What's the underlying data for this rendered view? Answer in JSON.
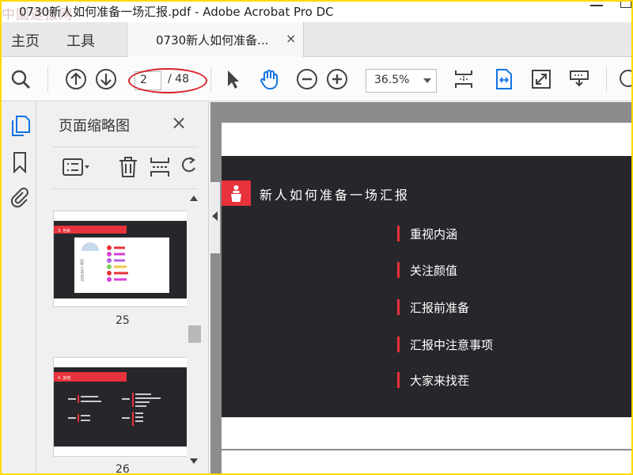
{
  "window": {
    "title": "0730新人如何准备一场汇报.pdf - Adobe Acrobat Pro DC",
    "watermark": "中国速报网"
  },
  "menu": {
    "home": "主页",
    "tools": "工具"
  },
  "tab": {
    "label": "0730新人如何准备...",
    "close": "×"
  },
  "toolbar": {
    "current_page": "2",
    "total_pages": "/ 48",
    "zoom": "36.5%"
  },
  "panel": {
    "title": "页面缩略图",
    "close": "×",
    "thumbs": [
      {
        "page": "25",
        "header": "3. 色彩",
        "center_label": "目录 CONTENT"
      },
      {
        "page": "26",
        "header": "4. 其他"
      }
    ]
  },
  "slide": {
    "title": "新人如何准备一场汇报",
    "items": [
      "重视内涵",
      "关注颜值",
      "汇报前准备",
      "汇报中注意事项",
      "大家来找茬"
    ]
  },
  "colors": {
    "accent_red": "#e8323c",
    "slide_bg": "#27262b",
    "acrobat_blue": "#1473e6"
  }
}
